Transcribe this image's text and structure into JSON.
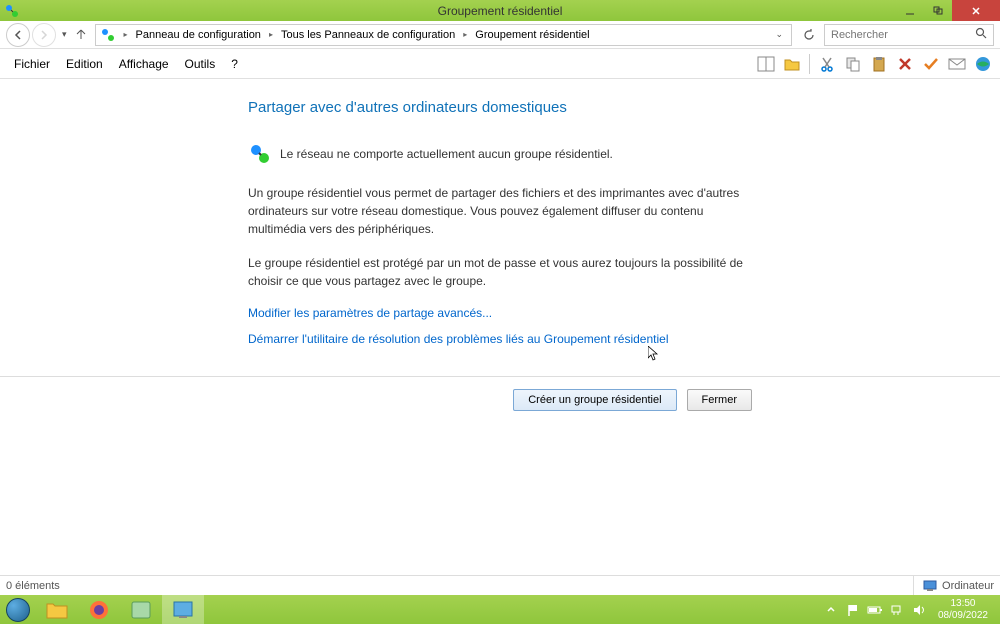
{
  "window": {
    "title": "Groupement résidentiel"
  },
  "breadcrumb": {
    "items": [
      "Panneau de configuration",
      "Tous les Panneaux de configuration",
      "Groupement résidentiel"
    ]
  },
  "search": {
    "placeholder": "Rechercher"
  },
  "menu": {
    "file": "Fichier",
    "edit": "Edition",
    "view": "Affichage",
    "tools": "Outils",
    "help": "?"
  },
  "content": {
    "title": "Partager avec d'autres ordinateurs domestiques",
    "status": "Le réseau ne comporte actuellement aucun groupe résidentiel.",
    "para1": "Un groupe résidentiel vous permet de partager des fichiers et des imprimantes avec d'autres ordinateurs sur votre réseau domestique. Vous pouvez également diffuser du contenu multimédia vers des périphériques.",
    "para2": "Le groupe résidentiel est protégé par un mot de passe et vous aurez toujours la possibilité de choisir ce que vous partagez avec le groupe.",
    "link1": "Modifier les paramètres de partage avancés...",
    "link2": "Démarrer l'utilitaire de résolution des problèmes liés au Groupement résidentiel"
  },
  "buttons": {
    "create": "Créer un groupe résidentiel",
    "close": "Fermer"
  },
  "statusbar": {
    "left": "0 éléments",
    "right": "Ordinateur"
  },
  "clock": {
    "time": "13:50",
    "date": "08/09/2022"
  }
}
